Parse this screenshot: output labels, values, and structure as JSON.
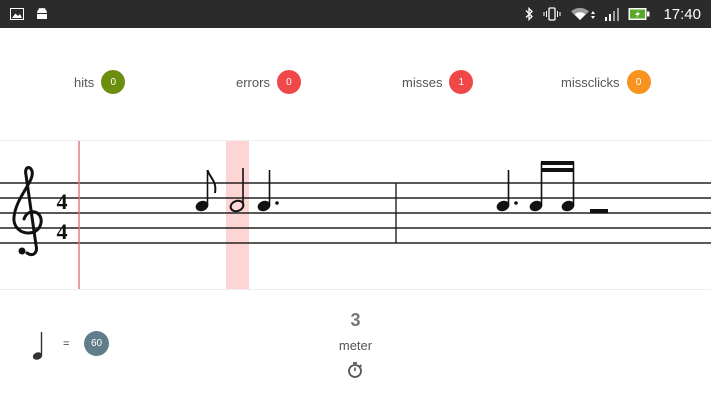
{
  "status_bar": {
    "time": "17:40",
    "icons": [
      "image-icon",
      "android-icon",
      "bluetooth-icon",
      "vibrate-icon",
      "wifi-icon",
      "signal-icon",
      "battery-charging-icon"
    ]
  },
  "stats": [
    {
      "label": "hits",
      "value": "0",
      "color": "#6b8e0e"
    },
    {
      "label": "errors",
      "value": "0",
      "color": "#f04848"
    },
    {
      "label": "misses",
      "value": "1",
      "color": "#f04848"
    },
    {
      "label": "missclicks",
      "value": "0",
      "color": "#f7931e"
    }
  ],
  "score": {
    "time_signature": {
      "top": "4",
      "bottom": "4"
    },
    "clef": "treble-clef",
    "highlight_color": "#fdd5d5",
    "cursor_color": "#e57373"
  },
  "tempo": {
    "equals": "=",
    "bpm": "60"
  },
  "meter": {
    "count": "3",
    "label": "meter"
  },
  "colors": {
    "status_bar": "#2b2b2b",
    "bpm_badge": "#607d8b"
  }
}
